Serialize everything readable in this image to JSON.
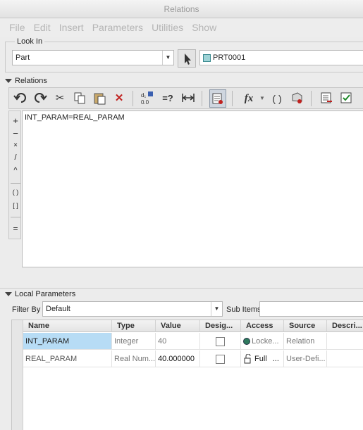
{
  "window": {
    "title": "Relations"
  },
  "menu": [
    "File",
    "Edit",
    "Insert",
    "Parameters",
    "Utilities",
    "Show"
  ],
  "look_in": {
    "label": "Look In",
    "type_value": "Part",
    "model_value": "PRT0001"
  },
  "relations": {
    "header": "Relations",
    "toolbar_icons": [
      "undo-icon",
      "redo-icon",
      "cut-icon",
      "copy-icon",
      "paste-icon",
      "delete-icon",
      "evaluate-icon",
      "verify-icon",
      "dimension-icon",
      "sort-relations-icon",
      "function-icon",
      "bracket-icon",
      "parameter-icon",
      "show-report-icon",
      "verify-relations-icon"
    ],
    "operators": [
      "+",
      "−",
      "×",
      "/",
      "^",
      "( )",
      "[ ]",
      "="
    ],
    "fx_label": "fx",
    "eq_label": "=?",
    "bracket_label": "( )",
    "text": "INT_PARAM=REAL_PARAM"
  },
  "local_parameters": {
    "header": "Local Parameters",
    "filter_label": "Filter By",
    "filter_value": "Default",
    "sub_items_label": "Sub Items",
    "columns": [
      "Name",
      "Type",
      "Value",
      "Desig...",
      "Access",
      "Source",
      "Descri..."
    ],
    "rows": [
      {
        "name": "INT_PARAM",
        "type": "Integer",
        "value": "40",
        "access": "Locke...",
        "source": "Relation",
        "selected": true
      },
      {
        "name": "REAL_PARAM",
        "type": "Real Num...",
        "value": "40.000000",
        "access": "Full",
        "source": "User-Defi...",
        "selected": false
      }
    ]
  },
  "colors": {
    "selected_row": "#b7dcf5",
    "disabled_text": "#b5b5b5"
  }
}
